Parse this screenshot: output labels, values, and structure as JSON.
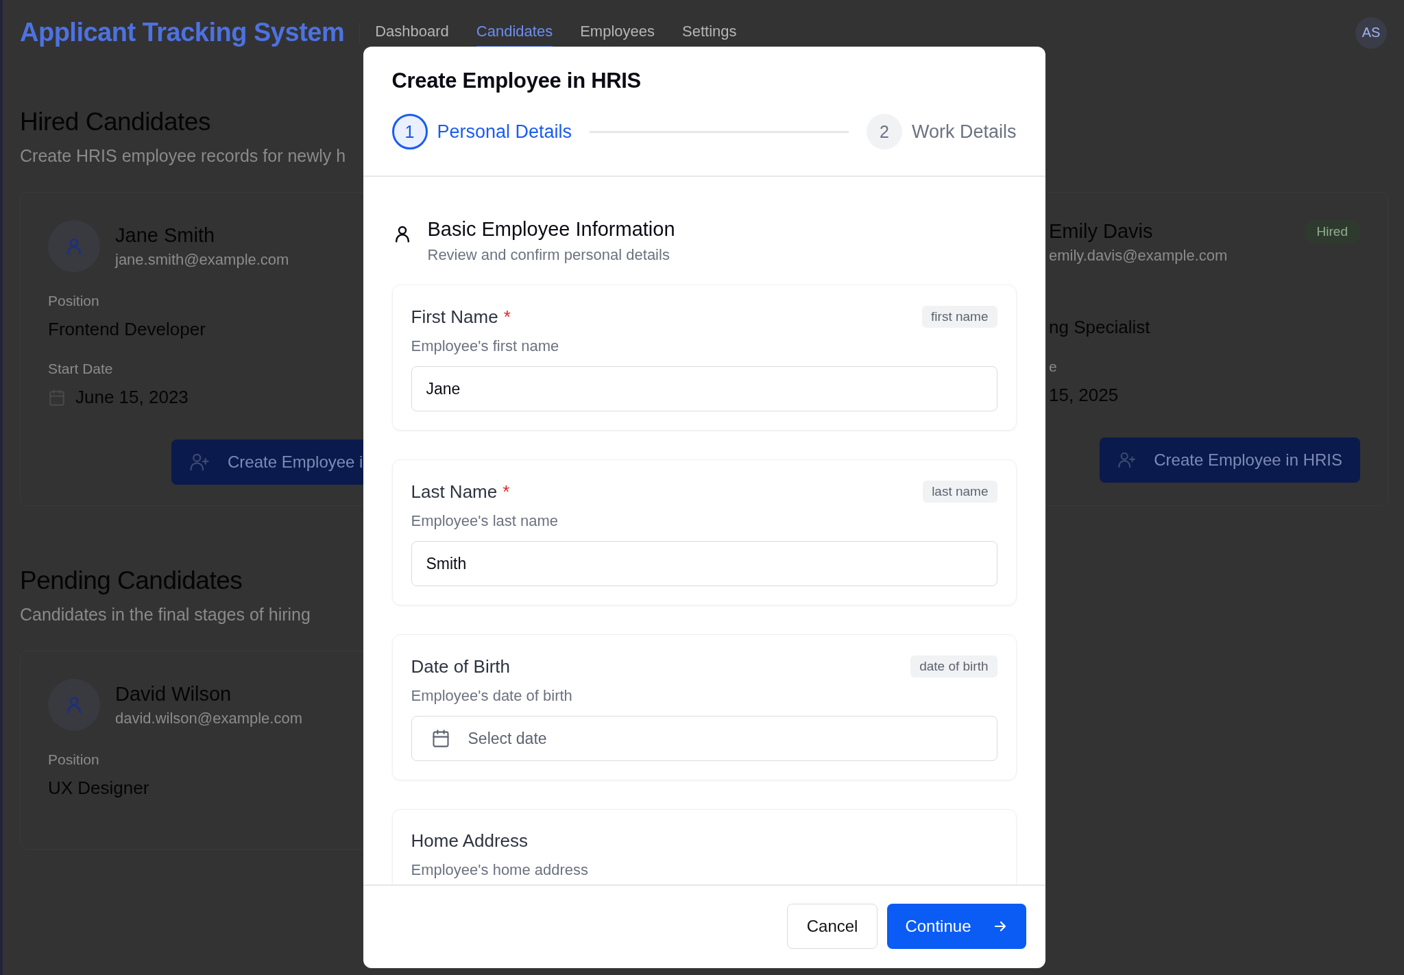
{
  "app": {
    "title": "Applicant Tracking System",
    "avatar": "AS",
    "nav": [
      {
        "label": "Dashboard",
        "selected": false
      },
      {
        "label": "Candidates",
        "selected": true
      },
      {
        "label": "Employees",
        "selected": false
      },
      {
        "label": "Settings",
        "selected": false
      }
    ]
  },
  "hired": {
    "heading": "Hired Candidates",
    "subtitle": "Create HRIS employee records for newly h",
    "candidates": [
      {
        "name": "Jane Smith",
        "email": "jane.smith@example.com",
        "position_label": "Position",
        "position": "Frontend Developer",
        "start_label": "Start Date",
        "start_date": "June 15, 2023",
        "button": "Create Employee i"
      },
      {
        "name": "Emily Davis",
        "email": "emily.davis@example.com",
        "badge": "Hired",
        "position": "ng Specialist",
        "start_label": "e",
        "start_date": "15, 2025",
        "button": "Create Employee in HRIS"
      }
    ]
  },
  "pending": {
    "heading": "Pending Candidates",
    "subtitle": "Candidates in the final stages of hiring",
    "candidates": [
      {
        "name": "David Wilson",
        "email": "david.wilson@example.com",
        "position_label": "Position",
        "position": "UX Designer"
      }
    ]
  },
  "dialog": {
    "title": "Create Employee in HRIS",
    "steps": [
      {
        "number": "1",
        "label": "Personal Details",
        "selected": true
      },
      {
        "number": "2",
        "label": "Work Details",
        "selected": false
      }
    ],
    "section": {
      "title": "Basic Employee Information",
      "subtitle": "Review and confirm personal details"
    },
    "fields": [
      {
        "kind": "text",
        "label": "First Name",
        "required_mark": "*",
        "tag": "first name",
        "hint": "Employee's first name",
        "value": "Jane"
      },
      {
        "kind": "text",
        "label": "Last Name",
        "required_mark": "*",
        "tag": "last name",
        "hint": "Employee's last name",
        "value": "Smith"
      },
      {
        "kind": "date",
        "label": "Date of Birth",
        "tag": "date of birth",
        "hint": "Employee's date of birth",
        "placeholder": "Select date"
      },
      {
        "kind": "text",
        "label": "Home Address",
        "hint": "Employee's home address"
      }
    ],
    "cancel": "Cancel",
    "continue": "Continue"
  }
}
